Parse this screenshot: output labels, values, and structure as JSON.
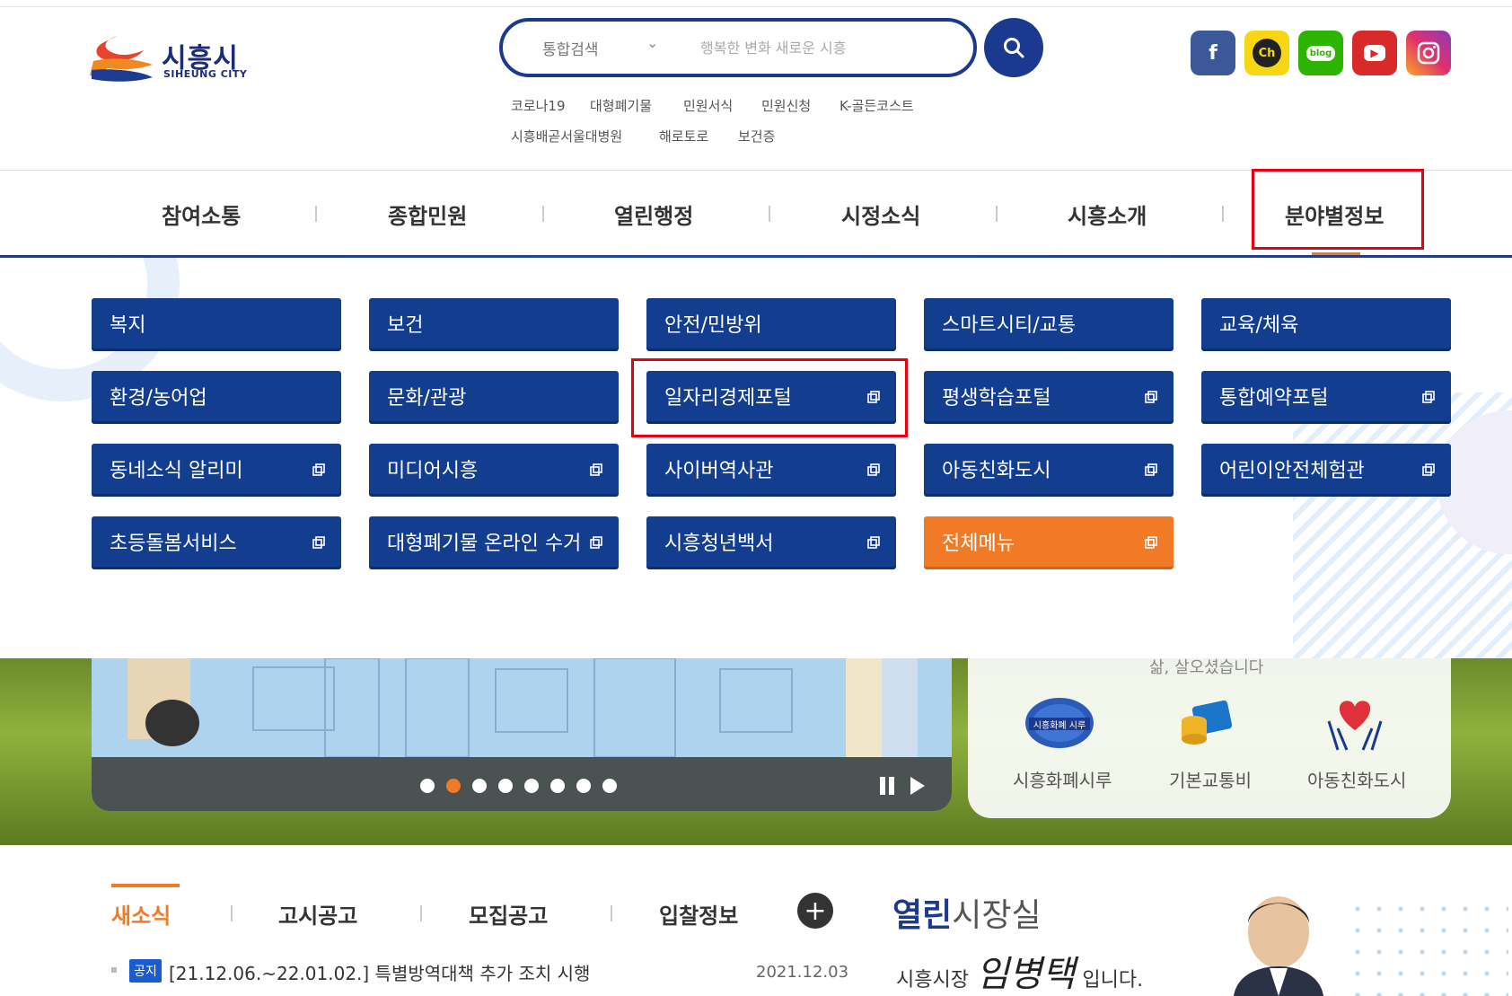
{
  "header": {
    "logo": {
      "ko": "시흥시",
      "en": "SIHEUNG CITY"
    },
    "search": {
      "category": "통합검색",
      "placeholder": "행복한 변화 새로운 시흥"
    },
    "keywords_row1": [
      "코로나19",
      "대형폐기물",
      "민원서식",
      "민원신청",
      "K-골든코스트"
    ],
    "keywords_row2": [
      "시흥배곧서울대병원",
      "해로토로",
      "보건증"
    ],
    "sns": [
      {
        "name": "facebook",
        "label": "f",
        "color": "#3b5998"
      },
      {
        "name": "kakao-channel",
        "label": "Ch",
        "color": "#f7d713"
      },
      {
        "name": "blog",
        "label": "blog",
        "color": "#2db400"
      },
      {
        "name": "youtube",
        "label": "▶",
        "color": "#d92a2a"
      },
      {
        "name": "instagram",
        "label": "◎",
        "color": "#d6336c"
      }
    ]
  },
  "gnb": {
    "items": [
      "참여소통",
      "종합민원",
      "열린행정",
      "시정소식",
      "시흥소개",
      "분야별정보"
    ],
    "active": "분야별정보"
  },
  "submenu": {
    "rows": [
      [
        {
          "label": "복지",
          "ext": false
        },
        {
          "label": "보건",
          "ext": false
        },
        {
          "label": "안전/민방위",
          "ext": false
        },
        {
          "label": "스마트시티/교통",
          "ext": false
        },
        {
          "label": "교육/체육",
          "ext": false
        }
      ],
      [
        {
          "label": "환경/농어업",
          "ext": false
        },
        {
          "label": "문화/관광",
          "ext": false
        },
        {
          "label": "일자리경제포털",
          "ext": true
        },
        {
          "label": "평생학습포털",
          "ext": true
        },
        {
          "label": "통합예약포털",
          "ext": true
        }
      ],
      [
        {
          "label": "동네소식 알리미",
          "ext": true
        },
        {
          "label": "미디어시흥",
          "ext": true
        },
        {
          "label": "사이버역사관",
          "ext": true
        },
        {
          "label": "아동친화도시",
          "ext": true
        },
        {
          "label": "어린이안전체험관",
          "ext": true
        }
      ],
      [
        {
          "label": "초등돌봄서비스",
          "ext": true
        },
        {
          "label": "대형폐기물 온라인 수거",
          "ext": true
        },
        {
          "label": "시흥청년백서",
          "ext": true
        },
        {
          "label": "전체메뉴",
          "ext": true,
          "orange": true
        }
      ]
    ]
  },
  "visual": {
    "slider_dots": 8,
    "active_dot": 1,
    "quick_top_text": "삶, 살오셨습니다",
    "quick_links": [
      "시흥화폐시루",
      "기본교통비",
      "아동친화도시"
    ],
    "sirue_badge": "시흥화폐 시루"
  },
  "news": {
    "tabs": [
      "새소식",
      "고시공고",
      "모집공고",
      "입찰정보"
    ],
    "active_tab": "새소식",
    "notice": {
      "badge": "공지",
      "title": "[21.12.06.~22.01.02.] 특별방역대책 추가 조치 시행",
      "date": "2021.12.03"
    }
  },
  "mayor": {
    "title_bold": "열린",
    "title_rest": "시장실",
    "prefix": "시흥시장",
    "name": "임병택",
    "suffix": "입니다."
  },
  "colors": {
    "primary": "#133d8f",
    "accent": "#f07a26",
    "highlight": "#e60012"
  }
}
